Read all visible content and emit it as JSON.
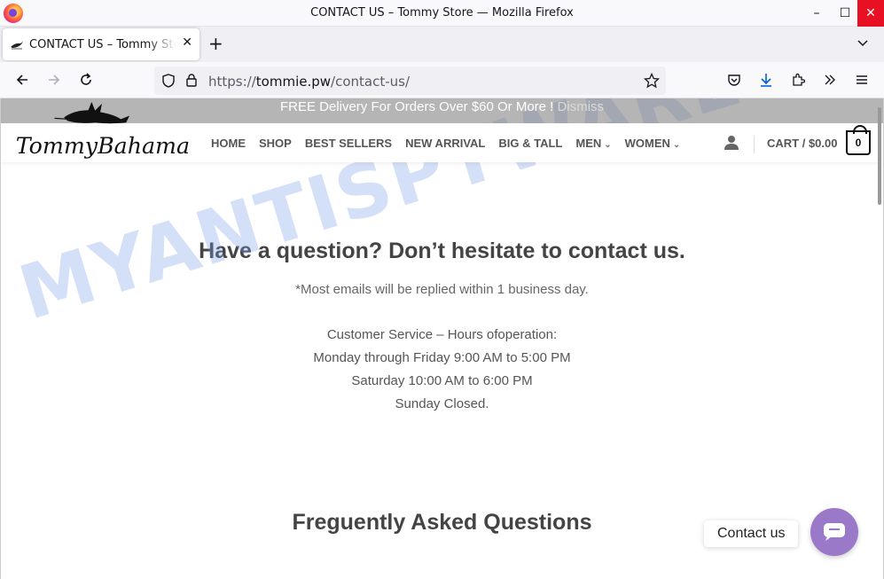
{
  "window": {
    "title": "CONTACT US – Tommy Store — Mozilla Firefox",
    "controls": {
      "minimize": "–",
      "maximize": "☐",
      "close": "✕"
    }
  },
  "tabs": [
    {
      "title": "CONTACT US – Tommy Store",
      "active": true
    }
  ],
  "newtab_label": "+",
  "navbar": {
    "url_prefix": "https://",
    "url_domain": "tommie.pw",
    "url_path": "/contact-us/"
  },
  "site": {
    "promo_text": "FREE Delivery For Orders Over $60 Or More !",
    "promo_dismiss": "Dismiss",
    "logo_text": "Tommy Bahama",
    "menu": [
      {
        "label": "HOME",
        "dropdown": false
      },
      {
        "label": "SHOP",
        "dropdown": false
      },
      {
        "label": "BEST SELLERS",
        "dropdown": false
      },
      {
        "label": "NEW ARRIVAL",
        "dropdown": false
      },
      {
        "label": "BIG & TALL",
        "dropdown": false
      },
      {
        "label": "MEN",
        "dropdown": true
      },
      {
        "label": "WOMEN",
        "dropdown": true
      }
    ],
    "cart_label": "CART / $0.00",
    "cart_count": "0"
  },
  "content": {
    "heading": "Have a question? Don’t hesitate to contact us.",
    "subtext": "*Most emails will be replied within 1 business day.",
    "hours": [
      "Customer Service – Hours ofoperation:",
      "Monday through Friday 9:00 AM to 5:00 PM",
      "Saturday 10:00 AM to 6:00 PM",
      "Sunday Closed."
    ],
    "faq_heading": "Freguently Asked Questions"
  },
  "widget": {
    "label": "Contact us"
  },
  "watermark": "MYANTISPYWARE.COM",
  "colors": {
    "widget": "#9b79c9",
    "close_button": "#e81123"
  }
}
